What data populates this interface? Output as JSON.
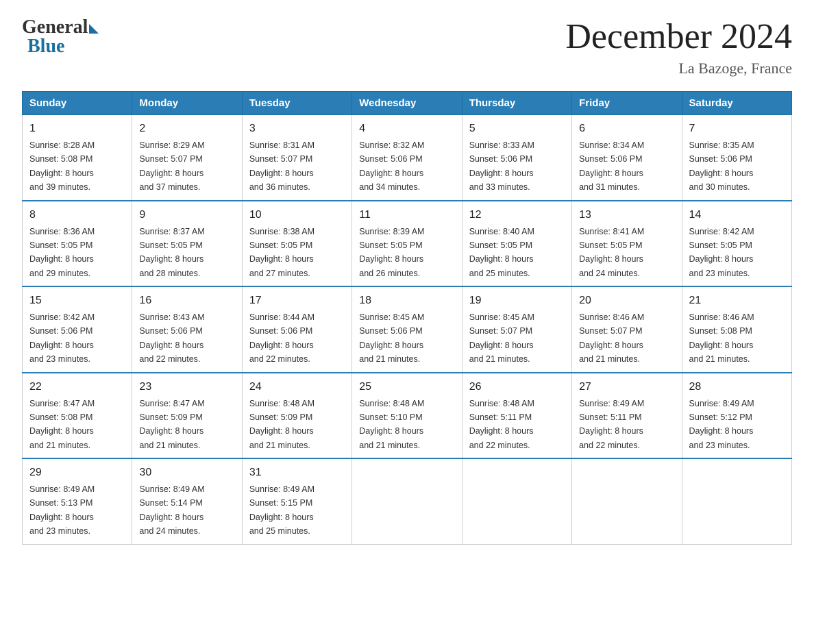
{
  "logo": {
    "general": "General",
    "blue": "Blue"
  },
  "title": "December 2024",
  "subtitle": "La Bazoge, France",
  "days_of_week": [
    "Sunday",
    "Monday",
    "Tuesday",
    "Wednesday",
    "Thursday",
    "Friday",
    "Saturday"
  ],
  "weeks": [
    [
      {
        "day": "1",
        "sunrise": "8:28 AM",
        "sunset": "5:08 PM",
        "daylight": "8 hours and 39 minutes."
      },
      {
        "day": "2",
        "sunrise": "8:29 AM",
        "sunset": "5:07 PM",
        "daylight": "8 hours and 37 minutes."
      },
      {
        "day": "3",
        "sunrise": "8:31 AM",
        "sunset": "5:07 PM",
        "daylight": "8 hours and 36 minutes."
      },
      {
        "day": "4",
        "sunrise": "8:32 AM",
        "sunset": "5:06 PM",
        "daylight": "8 hours and 34 minutes."
      },
      {
        "day": "5",
        "sunrise": "8:33 AM",
        "sunset": "5:06 PM",
        "daylight": "8 hours and 33 minutes."
      },
      {
        "day": "6",
        "sunrise": "8:34 AM",
        "sunset": "5:06 PM",
        "daylight": "8 hours and 31 minutes."
      },
      {
        "day": "7",
        "sunrise": "8:35 AM",
        "sunset": "5:06 PM",
        "daylight": "8 hours and 30 minutes."
      }
    ],
    [
      {
        "day": "8",
        "sunrise": "8:36 AM",
        "sunset": "5:05 PM",
        "daylight": "8 hours and 29 minutes."
      },
      {
        "day": "9",
        "sunrise": "8:37 AM",
        "sunset": "5:05 PM",
        "daylight": "8 hours and 28 minutes."
      },
      {
        "day": "10",
        "sunrise": "8:38 AM",
        "sunset": "5:05 PM",
        "daylight": "8 hours and 27 minutes."
      },
      {
        "day": "11",
        "sunrise": "8:39 AM",
        "sunset": "5:05 PM",
        "daylight": "8 hours and 26 minutes."
      },
      {
        "day": "12",
        "sunrise": "8:40 AM",
        "sunset": "5:05 PM",
        "daylight": "8 hours and 25 minutes."
      },
      {
        "day": "13",
        "sunrise": "8:41 AM",
        "sunset": "5:05 PM",
        "daylight": "8 hours and 24 minutes."
      },
      {
        "day": "14",
        "sunrise": "8:42 AM",
        "sunset": "5:05 PM",
        "daylight": "8 hours and 23 minutes."
      }
    ],
    [
      {
        "day": "15",
        "sunrise": "8:42 AM",
        "sunset": "5:06 PM",
        "daylight": "8 hours and 23 minutes."
      },
      {
        "day": "16",
        "sunrise": "8:43 AM",
        "sunset": "5:06 PM",
        "daylight": "8 hours and 22 minutes."
      },
      {
        "day": "17",
        "sunrise": "8:44 AM",
        "sunset": "5:06 PM",
        "daylight": "8 hours and 22 minutes."
      },
      {
        "day": "18",
        "sunrise": "8:45 AM",
        "sunset": "5:06 PM",
        "daylight": "8 hours and 21 minutes."
      },
      {
        "day": "19",
        "sunrise": "8:45 AM",
        "sunset": "5:07 PM",
        "daylight": "8 hours and 21 minutes."
      },
      {
        "day": "20",
        "sunrise": "8:46 AM",
        "sunset": "5:07 PM",
        "daylight": "8 hours and 21 minutes."
      },
      {
        "day": "21",
        "sunrise": "8:46 AM",
        "sunset": "5:08 PM",
        "daylight": "8 hours and 21 minutes."
      }
    ],
    [
      {
        "day": "22",
        "sunrise": "8:47 AM",
        "sunset": "5:08 PM",
        "daylight": "8 hours and 21 minutes."
      },
      {
        "day": "23",
        "sunrise": "8:47 AM",
        "sunset": "5:09 PM",
        "daylight": "8 hours and 21 minutes."
      },
      {
        "day": "24",
        "sunrise": "8:48 AM",
        "sunset": "5:09 PM",
        "daylight": "8 hours and 21 minutes."
      },
      {
        "day": "25",
        "sunrise": "8:48 AM",
        "sunset": "5:10 PM",
        "daylight": "8 hours and 21 minutes."
      },
      {
        "day": "26",
        "sunrise": "8:48 AM",
        "sunset": "5:11 PM",
        "daylight": "8 hours and 22 minutes."
      },
      {
        "day": "27",
        "sunrise": "8:49 AM",
        "sunset": "5:11 PM",
        "daylight": "8 hours and 22 minutes."
      },
      {
        "day": "28",
        "sunrise": "8:49 AM",
        "sunset": "5:12 PM",
        "daylight": "8 hours and 23 minutes."
      }
    ],
    [
      {
        "day": "29",
        "sunrise": "8:49 AM",
        "sunset": "5:13 PM",
        "daylight": "8 hours and 23 minutes."
      },
      {
        "day": "30",
        "sunrise": "8:49 AM",
        "sunset": "5:14 PM",
        "daylight": "8 hours and 24 minutes."
      },
      {
        "day": "31",
        "sunrise": "8:49 AM",
        "sunset": "5:15 PM",
        "daylight": "8 hours and 25 minutes."
      },
      null,
      null,
      null,
      null
    ]
  ],
  "labels": {
    "sunrise": "Sunrise:",
    "sunset": "Sunset:",
    "daylight": "Daylight:"
  }
}
